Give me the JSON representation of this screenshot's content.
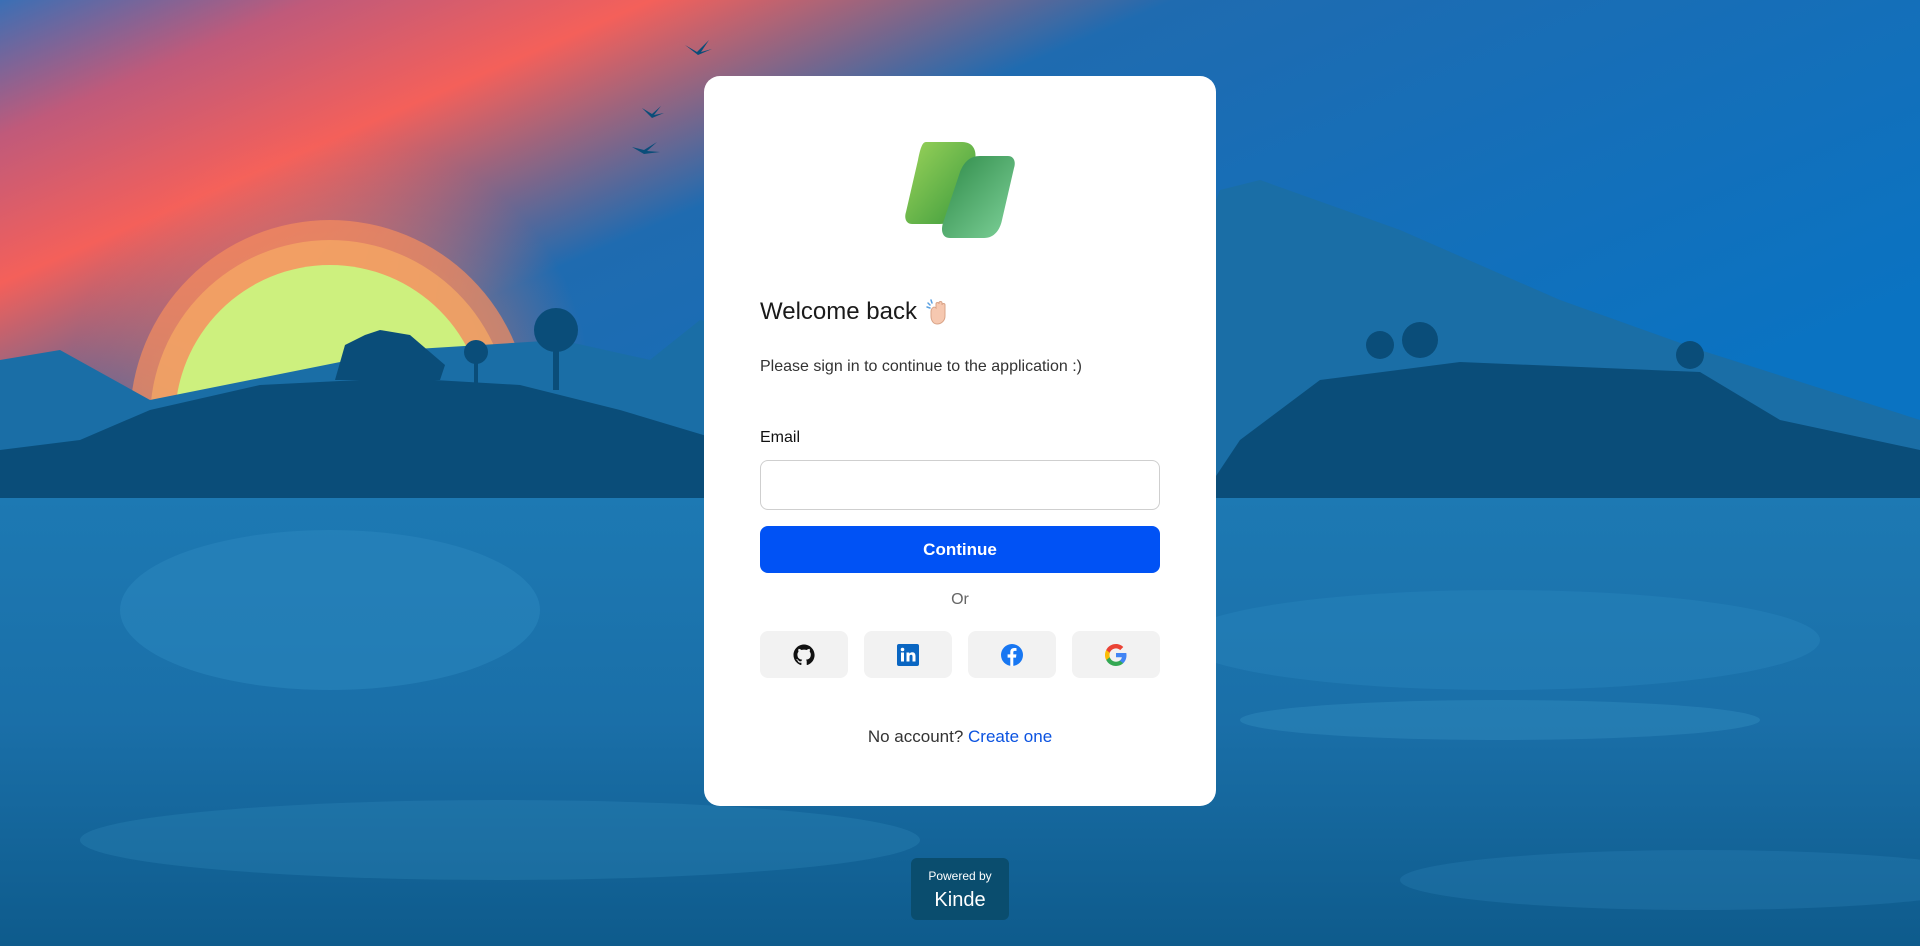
{
  "card": {
    "title": "Welcome back",
    "subtitle": "Please sign in to continue to the application :)",
    "email_label": "Email",
    "email_value": "",
    "continue_label": "Continue",
    "or_label": "Or",
    "signup_prompt": "No account?",
    "signup_link": "Create one"
  },
  "social": [
    {
      "name": "GitHub",
      "icon": "github-icon"
    },
    {
      "name": "LinkedIn",
      "icon": "linkedin-icon"
    },
    {
      "name": "Facebook",
      "icon": "facebook-icon"
    },
    {
      "name": "Google",
      "icon": "google-icon"
    }
  ],
  "footer": {
    "powered_by": "Powered by",
    "brand": "Kinde"
  },
  "colors": {
    "primary": "#0052f5",
    "link": "#0a52e0",
    "card_bg": "#ffffff",
    "social_bg": "#f2f2f2"
  }
}
